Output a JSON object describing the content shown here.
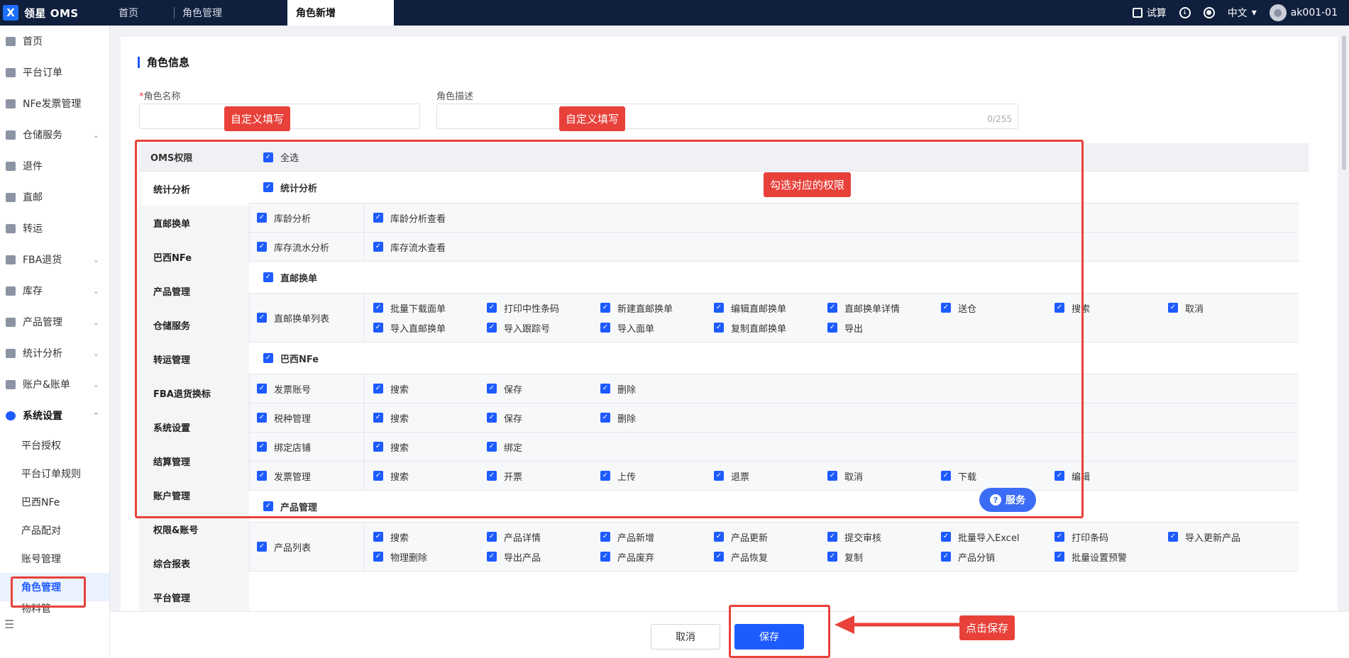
{
  "app": {
    "brand": "领星 OMS",
    "logo_letter": "X"
  },
  "tabs": [
    {
      "label": "首页"
    },
    {
      "label": "角色管理"
    },
    {
      "label": "角色新增"
    }
  ],
  "topright": {
    "calc": "试算",
    "lang": "中文",
    "user": "ak001-01"
  },
  "sidebar": {
    "items": [
      {
        "label": "首页",
        "icon": "home-icon"
      },
      {
        "label": "平台订单",
        "icon": "order-icon"
      },
      {
        "label": "NFe发票管理",
        "icon": "invoice-icon"
      },
      {
        "label": "仓储服务",
        "icon": "warehouse-icon",
        "chev": "⌄"
      },
      {
        "label": "退件",
        "icon": "return-icon"
      },
      {
        "label": "直邮",
        "icon": "mail-icon"
      },
      {
        "label": "转运",
        "icon": "transfer-icon"
      },
      {
        "label": "FBA退货",
        "icon": "fba-icon",
        "chev": "⌄"
      },
      {
        "label": "库存",
        "icon": "stock-icon",
        "chev": "⌄"
      },
      {
        "label": "产品管理",
        "icon": "product-icon",
        "chev": "⌄"
      },
      {
        "label": "统计分析",
        "icon": "chart-icon",
        "chev": "⌄"
      },
      {
        "label": "账户&账单",
        "icon": "account-icon",
        "chev": "⌄"
      },
      {
        "label": "系统设置",
        "icon": "settings-icon",
        "chev": "⌃"
      }
    ],
    "sub_items": [
      "平台授权",
      "平台订单规则",
      "巴西NFe",
      "产品配对",
      "账号管理",
      "角色管理",
      "物料管"
    ],
    "collapse": "☰"
  },
  "form": {
    "section_title": "角色信息",
    "name_label": "角色名称",
    "name_required": "*",
    "desc_label": "角色描述",
    "desc_counter": "0/255"
  },
  "annotations": {
    "name_hint": "自定义填写",
    "desc_hint": "自定义填写",
    "perm_hint": "勾选对应的权限",
    "save_hint": "点击保存"
  },
  "perm": {
    "left_header": "OMS权限",
    "select_all": "全选",
    "left_items": [
      "统计分析",
      "直邮换单",
      "巴西NFe",
      "产品管理",
      "仓储服务",
      "转运管理",
      "FBA退货换标",
      "系统设置",
      "结算管理",
      "账户管理",
      "权限&账号",
      "综合报表",
      "平台管理"
    ],
    "groups": [
      {
        "title": "统计分析",
        "rows": [
          {
            "name": "库龄分析",
            "opts": [
              "库龄分析查看"
            ]
          },
          {
            "name": "库存流水分析",
            "opts": [
              "库存流水查看"
            ]
          }
        ]
      },
      {
        "title": "直邮换单",
        "rows": [
          {
            "name": "直邮换单列表",
            "opts": [
              "批量下载面单",
              "打印中性条码",
              "新建直邮换单",
              "编辑直邮换单",
              "直邮换单详情",
              "送仓",
              "搜索",
              "取消",
              "导入直邮换单",
              "导入跟踪号",
              "导入面单",
              "复制直邮换单",
              "导出"
            ]
          }
        ]
      },
      {
        "title": "巴西NFe",
        "rows": [
          {
            "name": "发票账号",
            "opts": [
              "搜索",
              "保存",
              "删除"
            ]
          },
          {
            "name": "税种管理",
            "opts": [
              "搜索",
              "保存",
              "删除"
            ]
          },
          {
            "name": "绑定店铺",
            "opts": [
              "搜索",
              "绑定"
            ]
          },
          {
            "name": "发票管理",
            "opts": [
              "搜索",
              "开票",
              "上传",
              "退票",
              "取消",
              "下载",
              "编辑"
            ]
          }
        ]
      },
      {
        "title": "产品管理",
        "rows": [
          {
            "name": "产品列表",
            "opts": [
              "搜索",
              "产品详情",
              "产品新增",
              "产品更新",
              "提交审核",
              "批量导入Excel",
              "打印条码",
              "导入更新产品",
              "物理删除",
              "导出产品",
              "产品废弃",
              "产品恢复",
              "复制",
              "产品分销",
              "批量设置预警"
            ]
          }
        ]
      }
    ]
  },
  "service": {
    "label": "服务",
    "icon": "?"
  },
  "footer": {
    "cancel": "取消",
    "save": "保存"
  },
  "colors": {
    "accent": "#1e5bff",
    "annotation": "#e8413a",
    "topbar": "#0f1f3d"
  }
}
